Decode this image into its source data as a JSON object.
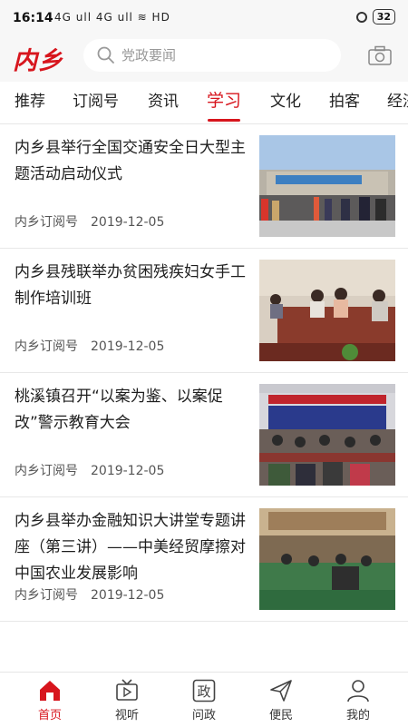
{
  "status_bar": {
    "time": "16:14",
    "network": "4G ull 4G ull ≋ HD",
    "battery": "32"
  },
  "header": {
    "logo_text": "内乡",
    "search_placeholder": "党政要闻",
    "camera_icon": "camera-icon"
  },
  "tabs": [
    {
      "label": "推荐"
    },
    {
      "label": "订阅号"
    },
    {
      "label": "资讯"
    },
    {
      "label": "学习"
    },
    {
      "label": "文化"
    },
    {
      "label": "拍客"
    },
    {
      "label": "经济"
    }
  ],
  "active_tab": "学习",
  "news": [
    {
      "title": "内乡县举行全国交通安全日大型主题活动启动仪式",
      "source": "内乡订阅号",
      "date": "2019-12-05",
      "image_icon": "traffic-safety-photo"
    },
    {
      "title": "内乡县残联举办贫困残疾妇女手工制作培训班",
      "source": "内乡订阅号",
      "date": "2019-12-05",
      "image_icon": "handcraft-training-photo"
    },
    {
      "title": "桃溪镇召开“以案为鉴、以案促改”警示教育大会",
      "source": "内乡订阅号",
      "date": "2019-12-05",
      "image_icon": "education-meeting-photo"
    },
    {
      "title": "内乡县举办金融知识大讲堂专题讲座（第三讲）——中美经贸摩擦对中国农业发展影响",
      "source": "内乡订阅号",
      "date": "2019-12-05",
      "image_icon": "finance-lecture-photo"
    }
  ],
  "bottom_nav": [
    {
      "label": "首页",
      "icon": "home-icon"
    },
    {
      "label": "视听",
      "icon": "tv-icon"
    },
    {
      "label": "问政",
      "icon": "zheng-icon",
      "icon_text": "政"
    },
    {
      "label": "便民",
      "icon": "send-icon"
    },
    {
      "label": "我的",
      "icon": "user-icon"
    }
  ],
  "colors": {
    "accent": "#d7151d",
    "text": "#1e1e1e",
    "meta": "#555555"
  }
}
